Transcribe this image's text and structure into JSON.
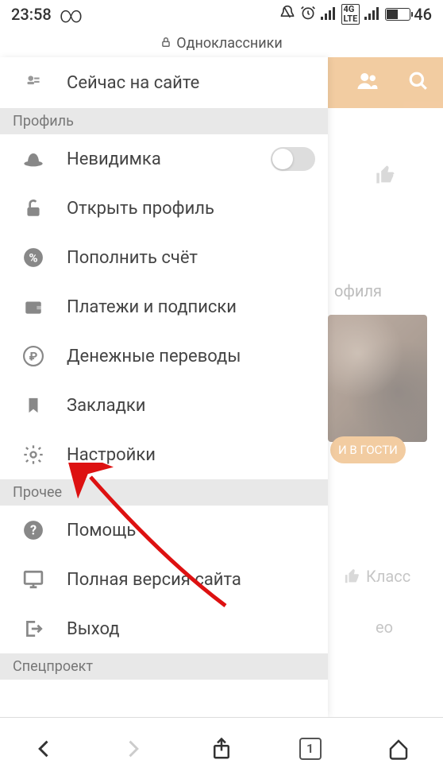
{
  "status": {
    "time": "23:58",
    "battery_pct": "46",
    "net_label": "4G LTE"
  },
  "title": "Одноклассники",
  "drawer": {
    "top_item": "Сейчас на сайте",
    "sections": {
      "profile": {
        "header": "Профиль",
        "items": {
          "invisible": "Невидимка",
          "open_profile": "Открыть профиль",
          "topup": "Пополнить счёт",
          "payments": "Платежи и подписки",
          "transfers": "Денежные переводы",
          "bookmarks": "Закладки",
          "settings": "Настройки"
        }
      },
      "other": {
        "header": "Прочее",
        "items": {
          "help": "Помощь",
          "full_site": "Полная версия сайта",
          "exit": "Выход"
        }
      },
      "special": {
        "header": "Спецпроект"
      }
    }
  },
  "background": {
    "profile_frag": "офиля",
    "visit_button": "И В ГОСТИ",
    "class_label": "Класс",
    "eo_frag": "ео"
  },
  "bottom": {
    "tab_count": "1"
  }
}
